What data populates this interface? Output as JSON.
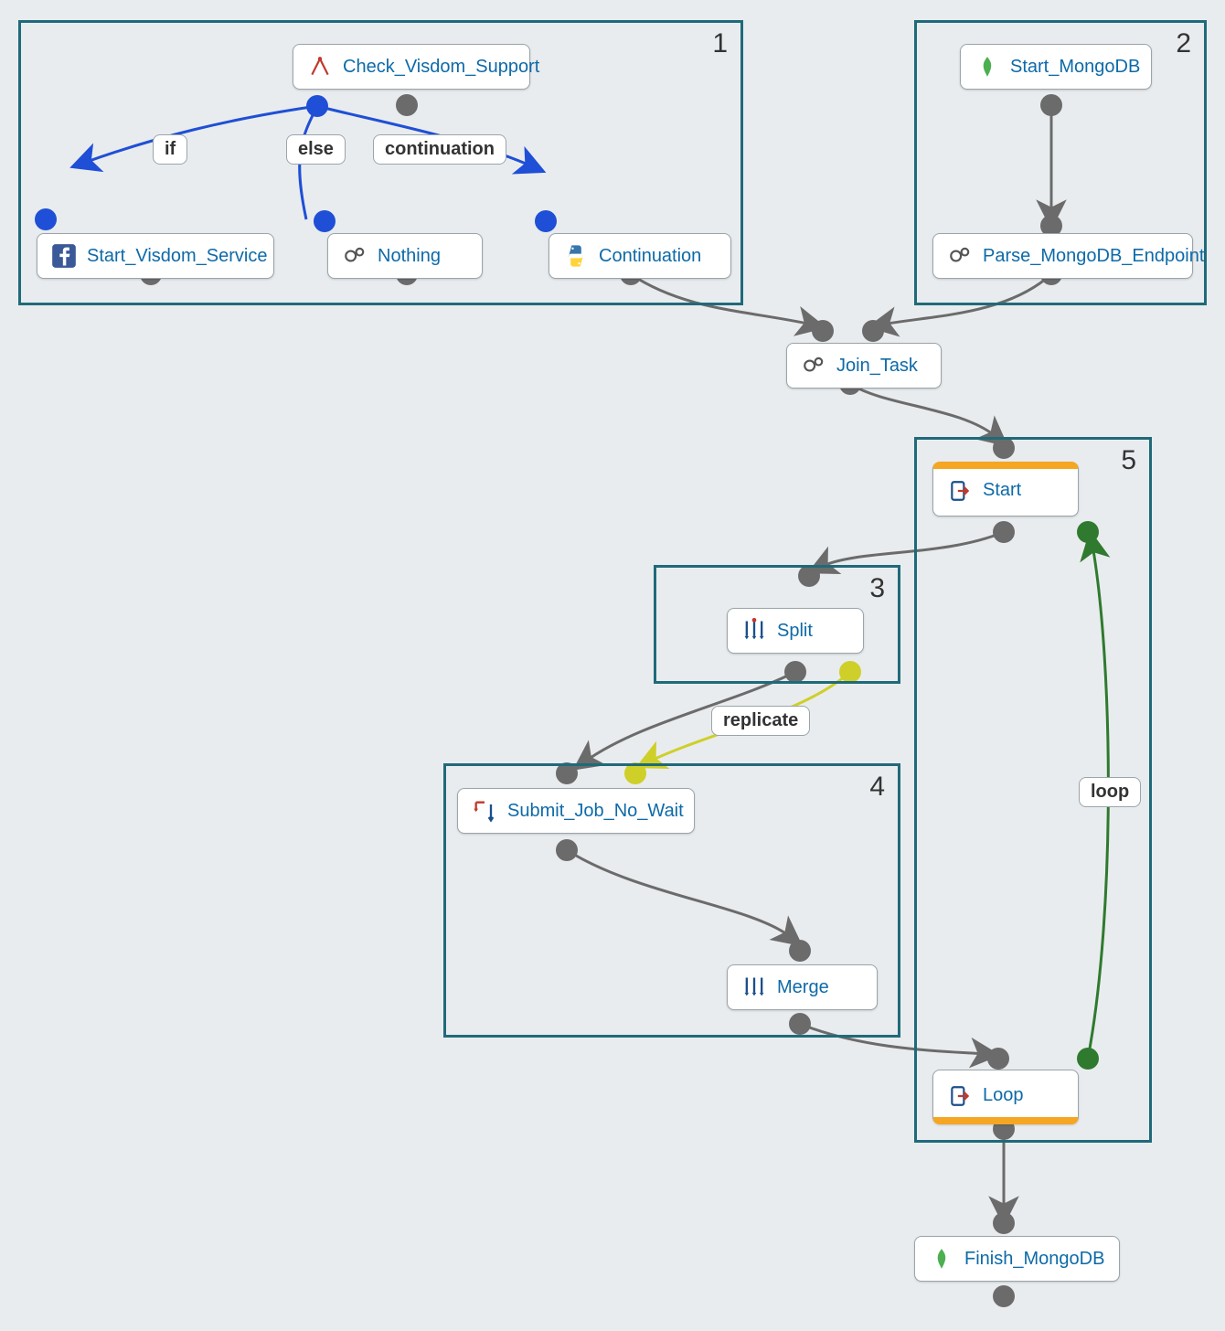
{
  "groups": {
    "g1": {
      "label": "1"
    },
    "g2": {
      "label": "2"
    },
    "g3": {
      "label": "3"
    },
    "g4": {
      "label": "4"
    },
    "g5": {
      "label": "5"
    }
  },
  "nodes": {
    "check_visdom": "Check_Visdom_Support",
    "start_visdom": "Start_Visdom_Service",
    "nothing": "Nothing",
    "continuation_node": "Continuation",
    "start_mongo": "Start_MongoDB",
    "parse_mongo": "Parse_MongoDB_Endpoint",
    "join_task": "Join_Task",
    "start": "Start",
    "split": "Split",
    "submit_job": "Submit_Job_No_Wait",
    "merge": "Merge",
    "loop_node": "Loop",
    "finish_mongo": "Finish_MongoDB"
  },
  "badges": {
    "if": "if",
    "else": "else",
    "continuation": "continuation",
    "replicate": "replicate",
    "loop": "loop"
  },
  "colors": {
    "group_border": "#1f6a7a",
    "link_default": "#6b6b6b",
    "link_blue": "#1f4fd6",
    "link_green": "#2f7a2f",
    "link_yellow": "#cfcf2a",
    "port_gray": "#6b6b6b",
    "port_blue": "#1f4fd6",
    "port_yellow": "#cfcf2a",
    "port_green": "#2f7a2f",
    "accent_orange": "#f5a623"
  }
}
